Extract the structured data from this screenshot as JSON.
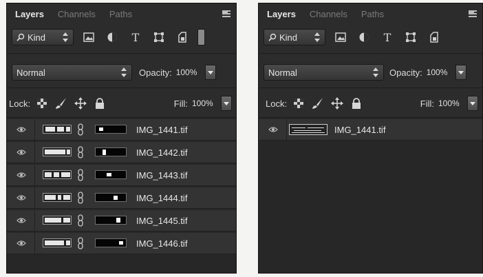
{
  "panels": [
    {
      "tabs": [
        "Layers",
        "Channels",
        "Paths"
      ],
      "kind": "Kind",
      "blend_mode": "Normal",
      "opacity_label": "Opacity:",
      "opacity_value": "100%",
      "lock_label": "Lock:",
      "fill_label": "Fill:",
      "fill_value": "100%",
      "layers": [
        "IMG_1441.tif",
        "IMG_1442.tif",
        "IMG_1443.tif",
        "IMG_1444.tif",
        "IMG_1445.tif",
        "IMG_1446.tif"
      ]
    },
    {
      "tabs": [
        "Layers",
        "Channels",
        "Paths"
      ],
      "kind": "Kind",
      "blend_mode": "Normal",
      "opacity_label": "Opacity:",
      "opacity_value": "100%",
      "lock_label": "Lock:",
      "fill_label": "Fill:",
      "fill_value": "100%",
      "layers": [
        "IMG_1441.tif"
      ]
    }
  ],
  "icons": {
    "filter_pixel": "image-icon",
    "filter_adjustment": "adjustment-circle-icon",
    "filter_type": "type-icon",
    "filter_shape": "shape-icon",
    "filter_smart": "smart-object-icon",
    "lock_pixels": "checkerboard-icon",
    "lock_image": "brush-icon",
    "lock_position": "move-icon",
    "lock_all": "padlock-icon",
    "visibility": "eye-icon",
    "link": "chain-link-icon"
  }
}
